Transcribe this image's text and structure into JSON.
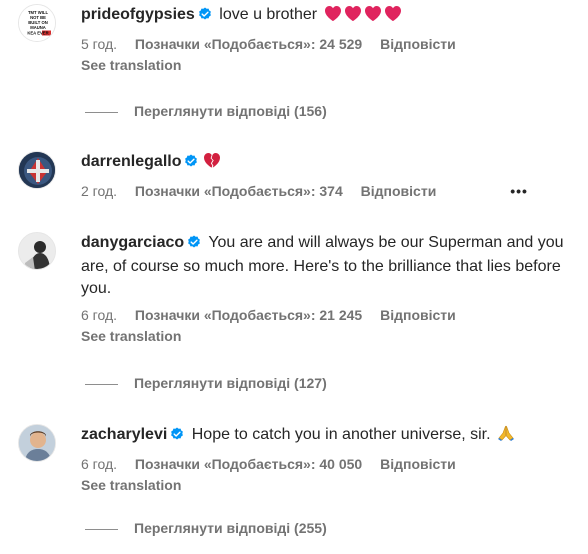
{
  "comments": [
    {
      "username": "prideofgypsies",
      "text": "love u brother",
      "emoji": [
        "red-heart",
        "red-heart",
        "red-heart",
        "red-heart"
      ],
      "time": "5 год.",
      "likes": "Позначки «Подобається»: 24 529",
      "reply": "Відповісти",
      "see_translation": "See translation",
      "view_replies": "Переглянути відповіді (156)",
      "avatar_text": [
        "TMT WILL",
        "NOT BE",
        "BUILT ON",
        "MAUNA",
        "KEA EVER"
      ]
    },
    {
      "username": "darrenlegallo",
      "text": "",
      "emoji": [
        "broken-heart"
      ],
      "time": "2 год.",
      "likes": "Позначки «Подобається»: 374",
      "reply": "Відповісти",
      "more": "•••"
    },
    {
      "username": "danygarciaco",
      "text": "You are and will always be our Superman and you are, of course so much more. Here's to the brilliance that lies before you.",
      "time": "6 год.",
      "likes": "Позначки «Подобається»: 21 245",
      "reply": "Відповісти",
      "see_translation": "See translation",
      "view_replies": "Переглянути відповіді (127)"
    },
    {
      "username": "zacharylevi",
      "text": "Hope to catch you in another universe, sir.",
      "emoji": [
        "folded-hands"
      ],
      "time": "6 год.",
      "likes": "Позначки «Подобається»: 40 050",
      "reply": "Відповісти",
      "see_translation": "See translation",
      "view_replies": "Переглянути відповіді (255)"
    }
  ],
  "colors": {
    "text": "#262626",
    "secondary": "#737373",
    "verified": "#0095f6",
    "heart": "#e0245e"
  }
}
